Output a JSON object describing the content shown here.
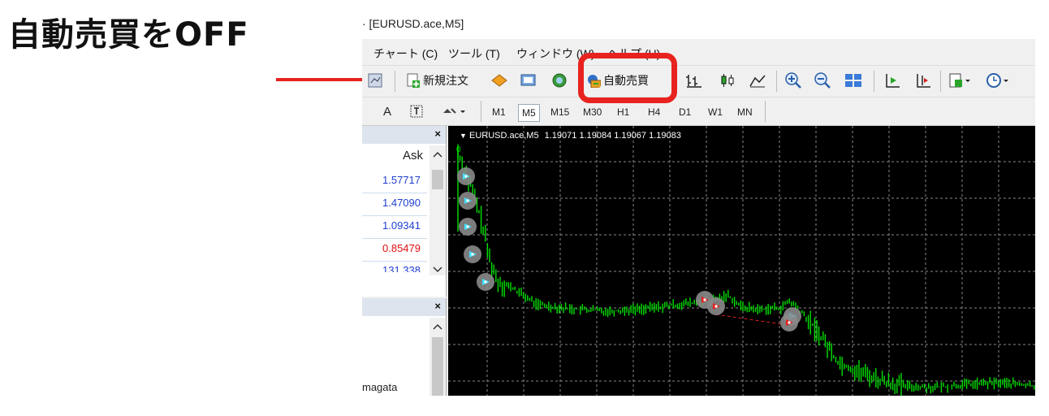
{
  "heading": "自動売買をOFF",
  "window": {
    "title": "· [EURUSD.ace,M5]"
  },
  "menu": {
    "items": [
      "チャート (C)",
      "ツール (T)",
      "ウィンドウ (W)",
      "ヘルプ (H)"
    ]
  },
  "toolbar": {
    "new_order_label": "新規注文",
    "auto_trade_label": "自動売買"
  },
  "timeframes": {
    "text_tool": "A",
    "items": [
      "M1",
      "M5",
      "M15",
      "M30",
      "H1",
      "H4",
      "D1",
      "W1",
      "MN"
    ],
    "active": "M5"
  },
  "market_watch": {
    "close": "×",
    "column": "Ask",
    "prices": [
      {
        "value": "1.57717",
        "color": "blue"
      },
      {
        "value": "1.47090",
        "color": "blue"
      },
      {
        "value": "1.09341",
        "color": "blue"
      },
      {
        "value": "0.85479",
        "color": "red"
      },
      {
        "value": "131.338",
        "color": "blue"
      }
    ]
  },
  "navigator": {
    "close": "×",
    "item": "magata"
  },
  "chart": {
    "symbol_label": "EURUSD.ace,M5",
    "ohlc": "1.19071 1.19084 1.19067 1.19083",
    "top_marker": "0"
  },
  "colors": {
    "accent": "#e8231f",
    "candle": "#00e000",
    "chart_bg": "#000000"
  }
}
